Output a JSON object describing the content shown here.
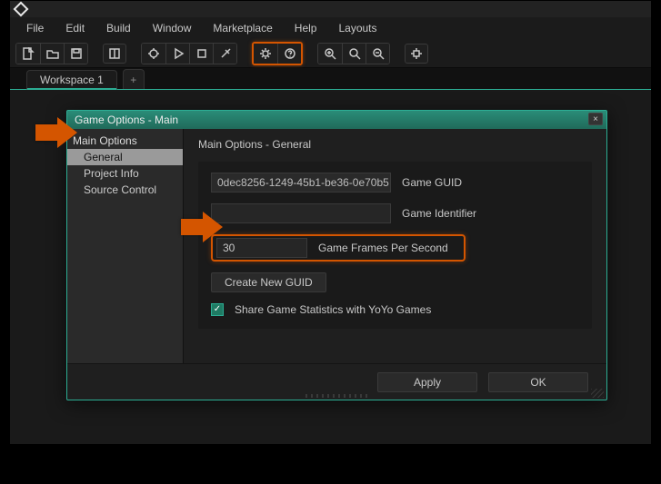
{
  "menu": {
    "file": "File",
    "edit": "Edit",
    "build": "Build",
    "window": "Window",
    "marketplace": "Marketplace",
    "help": "Help",
    "layouts": "Layouts"
  },
  "tabs": {
    "workspace": "Workspace 1",
    "plus": "+"
  },
  "dialog": {
    "title": "Game Options - Main",
    "close": "×",
    "tree": {
      "root": "Main Options",
      "general": "General",
      "project": "Project Info",
      "source": "Source Control"
    },
    "heading": "Main Options - General",
    "guid_value": "0dec8256-1249-45b1-be36-0e70b5",
    "guid_label": "Game GUID",
    "identifier_value": "",
    "identifier_label": "Game Identifier",
    "fps_value": "30",
    "fps_label": "Game Frames Per Second",
    "new_guid": "Create New GUID",
    "share": "Share Game Statistics with YoYo Games",
    "apply": "Apply",
    "ok": "OK"
  }
}
